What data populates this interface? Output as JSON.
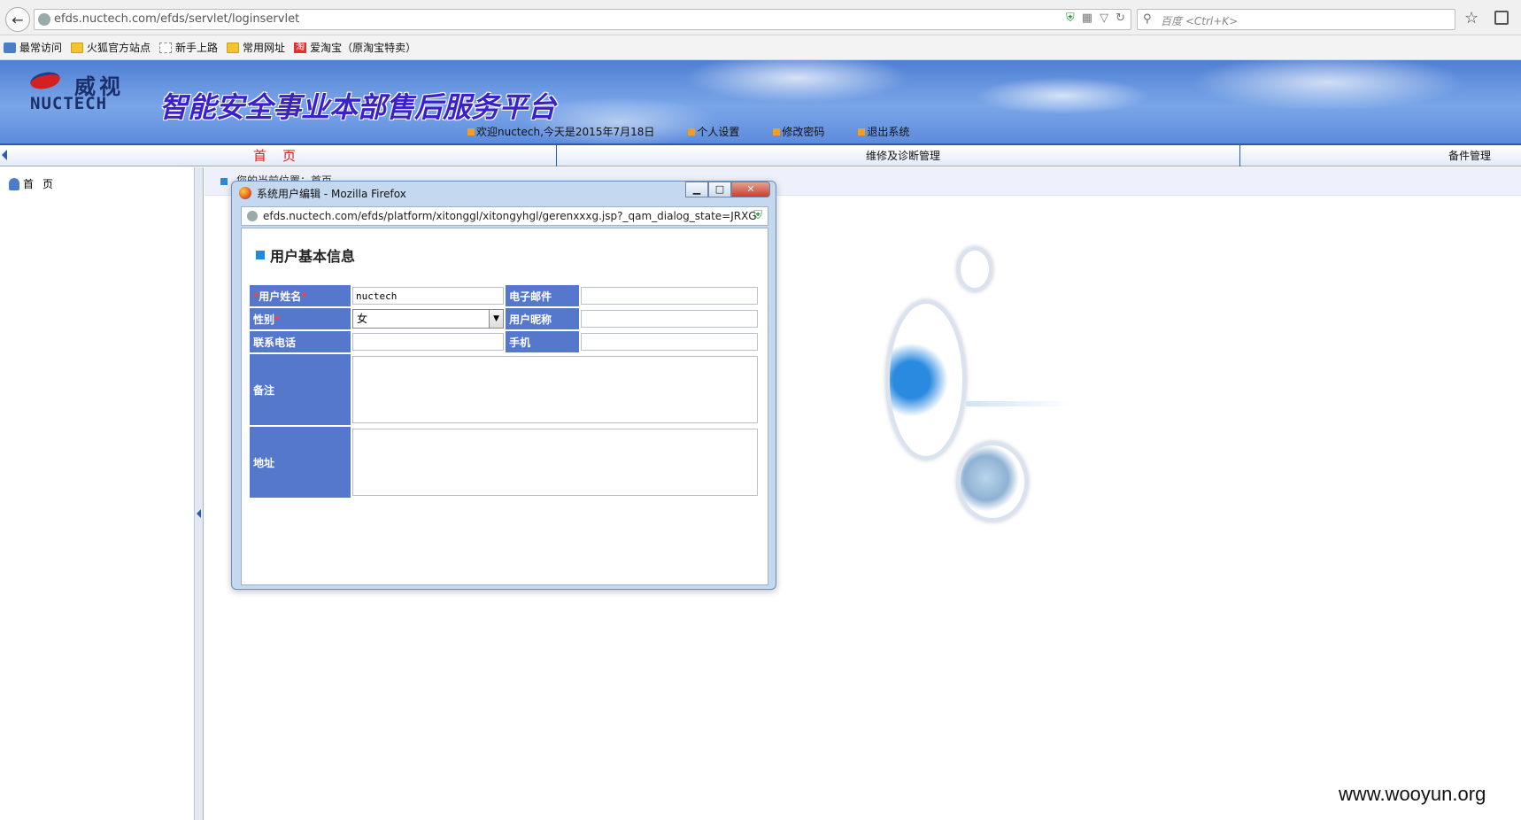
{
  "browser": {
    "url": "efds.nuctech.com/efds/servlet/loginservlet",
    "search_placeholder": "百度 <Ctrl+K>"
  },
  "bookmarks": [
    {
      "label": "最常访问",
      "icon": "pin-icon"
    },
    {
      "label": "火狐官方站点",
      "icon": "folder-icon"
    },
    {
      "label": "新手上路",
      "icon": "blank-page-icon"
    },
    {
      "label": "常用网址",
      "icon": "folder-icon"
    },
    {
      "label": "爱淘宝（原淘宝特卖）",
      "icon": "taobao-icon"
    }
  ],
  "header": {
    "logo_cn": "威视",
    "logo_en": "NUCTECH",
    "title": "智能安全事业本部售后服务平台",
    "welcome": "欢迎nuctech,今天是2015年7月18日",
    "links": [
      "个人设置",
      "修改密码",
      "退出系统"
    ]
  },
  "nav": {
    "home": "首页",
    "maintenance": "维修及诊断管理",
    "parts": "备件管理"
  },
  "left": {
    "home": "首页"
  },
  "breadcrumb": "您的当前位置：首页",
  "dialog": {
    "title": "系统用户编辑 - Mozilla Firefox",
    "url": "efds.nuctech.com/efds/platform/xitonggl/xitongyhgl/gerenxxxg.jsp?_qam_dialog_state=JRXG",
    "section_title": "用户基本信息",
    "labels": {
      "username": "用户姓名",
      "email": "电子邮件",
      "gender": "性别",
      "nickname": "用户昵称",
      "phone": "联系电话",
      "mobile": "手机",
      "remarks": "备注",
      "address": "地址"
    },
    "required_mark": "*",
    "values": {
      "username": "nuctech",
      "email": "",
      "gender": "女",
      "nickname": "",
      "phone": "",
      "mobile": ""
    },
    "controls": {
      "minimize": "▁",
      "maximize": "□",
      "close": "✕"
    }
  },
  "watermark": "www.wooyun.org"
}
